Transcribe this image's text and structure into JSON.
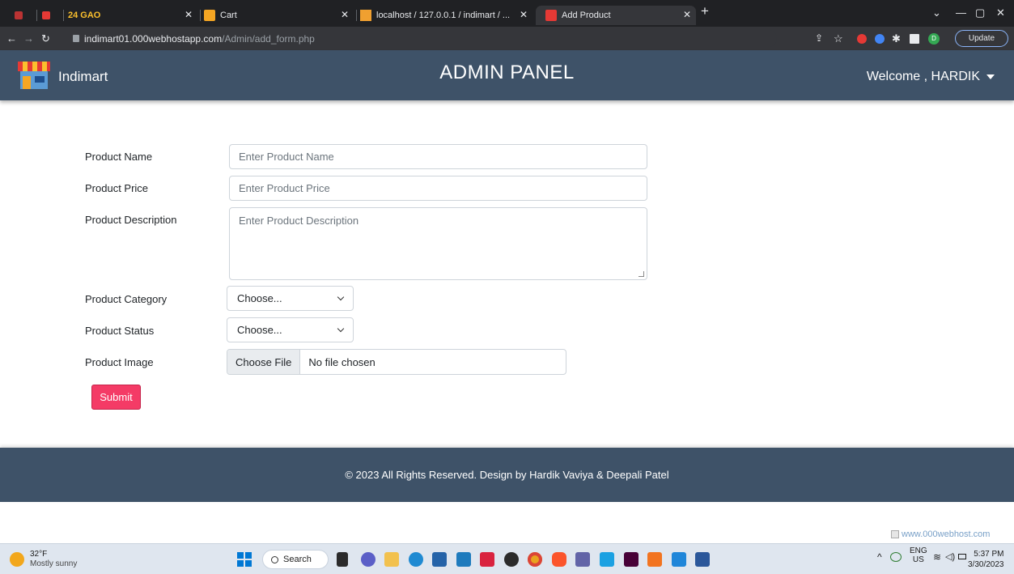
{
  "browser": {
    "tabs": [
      {
        "label": "24 GAO",
        "icon": "gao-icon"
      },
      {
        "label": "Cart",
        "icon": "cart-favicon"
      },
      {
        "label": "localhost / 127.0.0.1 / indimart / ...",
        "icon": "phpmyadmin-favicon"
      },
      {
        "label": "Add Product",
        "icon": "shop-favicon"
      }
    ],
    "new_tab": "+",
    "url_host": "indimart01.000webhostapp.com",
    "url_path": "/Admin/add_form.php",
    "profile_initial": "D",
    "update_label": "Update"
  },
  "header": {
    "brand": "Indimart",
    "title": "ADMIN PANEL",
    "welcome": "Welcome , HARDIK"
  },
  "form": {
    "name_label": "Product Name",
    "name_placeholder": "Enter Product Name",
    "price_label": "Product Price",
    "price_placeholder": "Enter Product Price",
    "desc_label": "Product Description",
    "desc_placeholder": "Enter Product Description",
    "category_label": "Product Category",
    "category_value": "Choose...",
    "status_label": "Product Status",
    "status_value": "Choose...",
    "image_label": "Product Image",
    "file_button": "Choose File",
    "file_text": "No file chosen",
    "submit": "Submit"
  },
  "footer": {
    "text": "© 2023 All Rights Reserved. Design by Hardik Vaviya & Deepali Patel"
  },
  "hosting_badge": "www.000webhost.com",
  "taskbar": {
    "temperature": "32°F",
    "condition": "Mostly sunny",
    "search": "Search",
    "lang_top": "ENG",
    "lang_bottom": "US",
    "time": "5:37 PM",
    "date": "3/30/2023"
  },
  "colors": {
    "header_bg": "#3e5268",
    "submit_bg": "#f43b66"
  }
}
